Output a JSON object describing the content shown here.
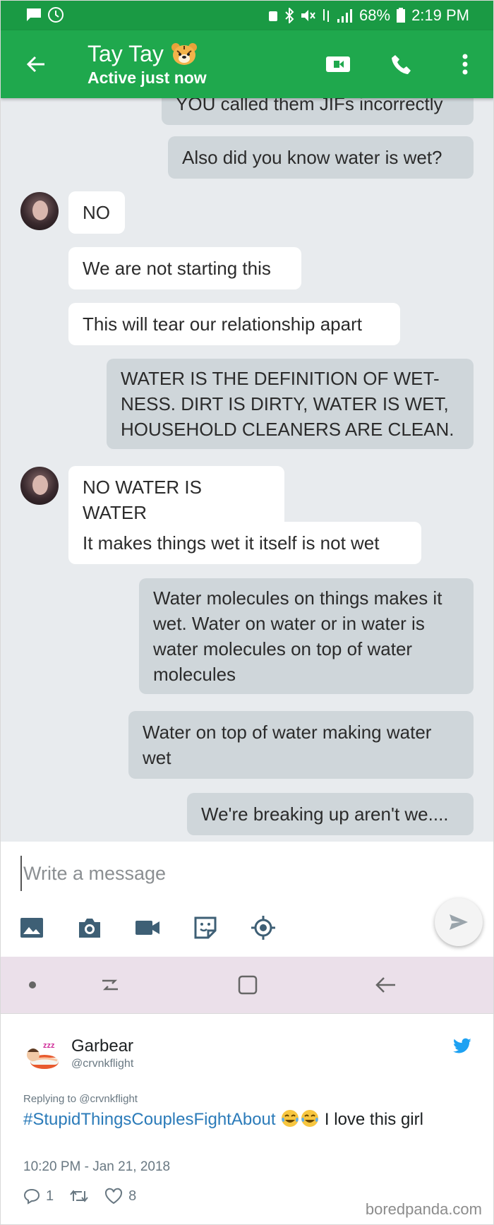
{
  "status_bar": {
    "battery": "68%",
    "time": "2:19 PM"
  },
  "header": {
    "contact_name": "Tay Tay",
    "status": "Active just now",
    "icons": [
      "back-arrow-icon",
      "video-call-icon",
      "phone-icon",
      "more-vert-icon"
    ]
  },
  "messages": [
    {
      "dir": "out",
      "text": "YOU called them JIFs incorrectly"
    },
    {
      "dir": "out",
      "text": "Also did you know water is wet?"
    },
    {
      "dir": "in",
      "text": "NO"
    },
    {
      "dir": "in",
      "text": "We are not starting this"
    },
    {
      "dir": "in",
      "text": "This will tear our relationship apart"
    },
    {
      "dir": "out",
      "text": "WATER IS THE DEFINITION OF WET- NESS. DIRT IS DIRTY, WATER IS WET, HOUSEHOLD CLEANERS ARE CLEAN."
    },
    {
      "dir": "in",
      "text": "NO WATER IS WATER"
    },
    {
      "dir": "in",
      "text": "It makes things wet it itself is not wet"
    },
    {
      "dir": "out",
      "text": "Water molecules on things makes it wet. Water on water or in water is water molecules on top of water molecules"
    },
    {
      "dir": "out",
      "text": "Water on top of water making water wet"
    },
    {
      "dir": "out",
      "text": "We're breaking up aren't we...."
    }
  ],
  "composer": {
    "placeholder": "Write a message",
    "tools": [
      "image-icon",
      "camera-icon",
      "video-icon",
      "sticker-icon",
      "location-icon"
    ]
  },
  "tweet": {
    "name": "Garbear",
    "handle": "@crvnkflight",
    "replying_to": "Replying to @crvnkflight",
    "hashtag": "#StupidThingsCouplesFightAbout",
    "text_after": " I love this girl",
    "date": "10:20 PM - Jan 21, 2018",
    "reply_count": "1",
    "like_count": "8"
  },
  "watermark": "boredpanda.com",
  "colors": {
    "status_bar": "#1a9a44",
    "app_bar": "#1fa84d",
    "incoming_bubble": "#ffffff",
    "outgoing_bubble": "#cfd6da",
    "hashtag": "#2b7bb9",
    "twitter_blue": "#1da1f2"
  }
}
